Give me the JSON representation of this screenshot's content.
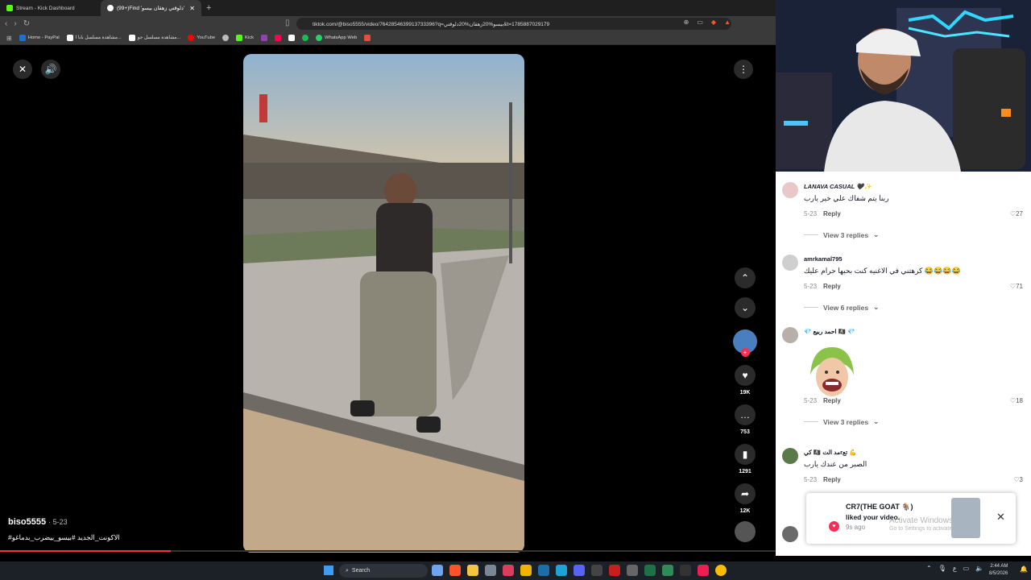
{
  "tabs": [
    {
      "title": "Stream - Kick Dashboard",
      "color": "#53fc18"
    },
    {
      "title": "(99+)Find 'دلوقتي زهقان بيسو'",
      "color": "#ffffff"
    }
  ],
  "url": "tiktok.com/@biso5555/video/7642854639913733396?q=بيسو%20زهقان%20دلوقتي&t=1785887029179",
  "bookmarks": [
    {
      "label": "Home - PayPal",
      "color": "#1f6fd1"
    },
    {
      "label": "مشاهدة مسلسل بابا ا...",
      "color": "#ffffff"
    },
    {
      "label": "مشاهدة مسلسل جو...",
      "color": "#ffffff"
    },
    {
      "label": "YouTube",
      "color": "#ff0000"
    },
    {
      "label": "",
      "color": "#bbbbbb"
    },
    {
      "label": "Kick",
      "color": "#53fc18"
    },
    {
      "label": "",
      "color": "#8e44ad"
    },
    {
      "label": "",
      "color": "#ff0050"
    },
    {
      "label": "",
      "color": "#ffffff"
    },
    {
      "label": "",
      "color": "#1db954"
    },
    {
      "label": "WhatsApp Web",
      "color": "#25d366"
    },
    {
      "label": "",
      "color": "#e74c3c"
    }
  ],
  "video": {
    "author": "biso5555",
    "date": "· 5-23",
    "caption": "#الاكونت_الجديد #بيسو_بيضرب_بدماغو",
    "progress": 0.22
  },
  "actions": {
    "likes": "19K",
    "comments": "753",
    "saves": "1291",
    "shares": "12K"
  },
  "comments": [
    {
      "name": "LANAVA CASUAL 🖤✨",
      "text": "ربنا يتم شفاك علي خير يارب",
      "date": "5-23",
      "reply": "Reply",
      "likes": "27",
      "replies": "View 3 replies",
      "avatar": "#e8c8c8"
    },
    {
      "name": "amrkamal795",
      "text": "كرهتني في الاغنيه كنت بحبها حرام عليك 😂😂😂😂",
      "date": "5-23",
      "reply": "Reply",
      "likes": "71",
      "replies": "View 6 replies",
      "avatar": "#cfcfcf"
    },
    {
      "name": "💎 احمد ربيع 🏴‍☠️ 💎",
      "text": "",
      "date": "5-23",
      "reply": "Reply",
      "likes": "18",
      "replies": "View 3 replies",
      "avatar": "#b8b0a8"
    },
    {
      "name": "مد الت 🏴‍☠️ كيrتع 💪",
      "text": "الصبر من عندك يارب",
      "date": "5-23",
      "reply": "Reply",
      "likes": "3",
      "replies": "",
      "avatar": "#5a7a4a"
    }
  ],
  "notification": {
    "user": "CR7(THE GOAT 🐐)",
    "text": "liked your video.",
    "time": "9s ago",
    "watermark1": "Activate Windows",
    "watermark2": "Go to Settings to activate Windows."
  },
  "taskbar": {
    "search": "Search",
    "time": "2:44 AM",
    "date": "8/5/2026",
    "lang": "ع"
  }
}
